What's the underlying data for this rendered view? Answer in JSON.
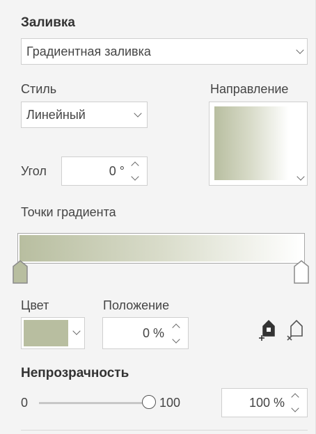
{
  "fill": {
    "title": "Заливка",
    "type_value": "Градиентная заливка"
  },
  "style": {
    "label": "Стиль",
    "value": "Линейный"
  },
  "direction": {
    "label": "Направление"
  },
  "angle": {
    "label": "Угол",
    "value": "0 °"
  },
  "gradient_points": {
    "label": "Точки градиента",
    "start_color": "#b8bea0",
    "end_color": "#ffffff"
  },
  "color": {
    "label": "Цвет",
    "swatch": "#b8bea0"
  },
  "position": {
    "label": "Положение",
    "value": "0 %"
  },
  "icons": {
    "add_point": "add-gradient-point-icon",
    "remove_point": "remove-gradient-point-icon"
  },
  "opacity": {
    "title": "Непрозрачность",
    "min_label": "0",
    "max_label": "100",
    "slider_value": 100,
    "value": "100 %"
  }
}
